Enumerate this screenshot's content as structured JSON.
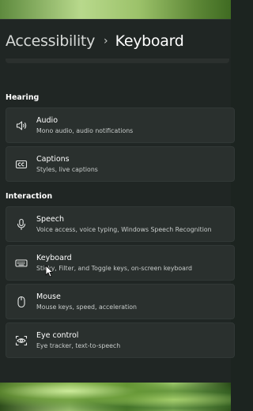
{
  "breadcrumb": {
    "parent": "Accessibility",
    "separator": "›",
    "current": "Keyboard"
  },
  "sections": {
    "hearing": "Hearing",
    "interaction": "Interaction"
  },
  "items": {
    "audio": {
      "title": "Audio",
      "desc": "Mono audio, audio notifications",
      "icon": "speaker-icon"
    },
    "captions": {
      "title": "Captions",
      "desc": "Styles, live captions",
      "icon": "cc-icon"
    },
    "speech": {
      "title": "Speech",
      "desc": "Voice access, voice typing, Windows Speech Recognition",
      "icon": "microphone-icon"
    },
    "keyboard": {
      "title": "Keyboard",
      "desc": "Sticky, Filter, and Toggle keys, on-screen keyboard",
      "icon": "keyboard-icon"
    },
    "mouse": {
      "title": "Mouse",
      "desc": "Mouse keys, speed, acceleration",
      "icon": "mouse-icon"
    },
    "eye_control": {
      "title": "Eye control",
      "desc": "Eye tracker, text-to-speech",
      "icon": "eye-control-icon"
    }
  },
  "colors": {
    "window_bg": "#202624",
    "card_bg": "#2a302e",
    "text": "#ffffff",
    "secondary_text": "#c8cccb"
  }
}
